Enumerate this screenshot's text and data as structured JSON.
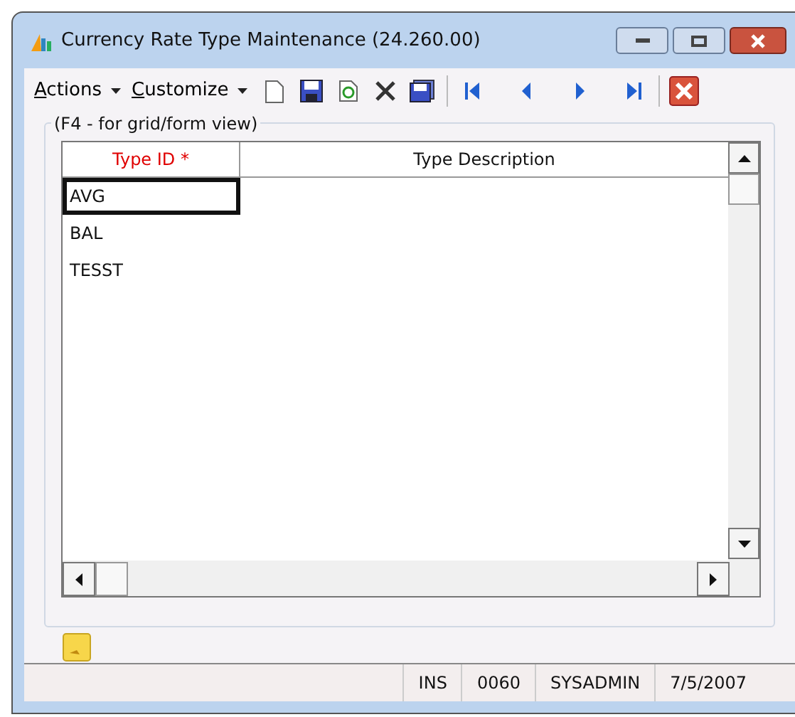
{
  "window": {
    "title": "Currency Rate Type Maintenance (24.260.00)"
  },
  "menus": [
    {
      "label": "Actions"
    },
    {
      "label": "Customize"
    }
  ],
  "group": {
    "caption": "(F4 - for grid/form view)"
  },
  "table": {
    "columns": [
      {
        "label": "Type ID *",
        "required": true
      },
      {
        "label": "Type Description",
        "required": false
      }
    ],
    "rows": [
      {
        "type_id": "AVG",
        "selected": true
      },
      {
        "type_id": "BAL",
        "selected": false
      },
      {
        "type_id": "TESST",
        "selected": false
      }
    ]
  },
  "status_bar": [
    "INS",
    "0060",
    "SYSADMIN",
    "7/5/2007"
  ]
}
